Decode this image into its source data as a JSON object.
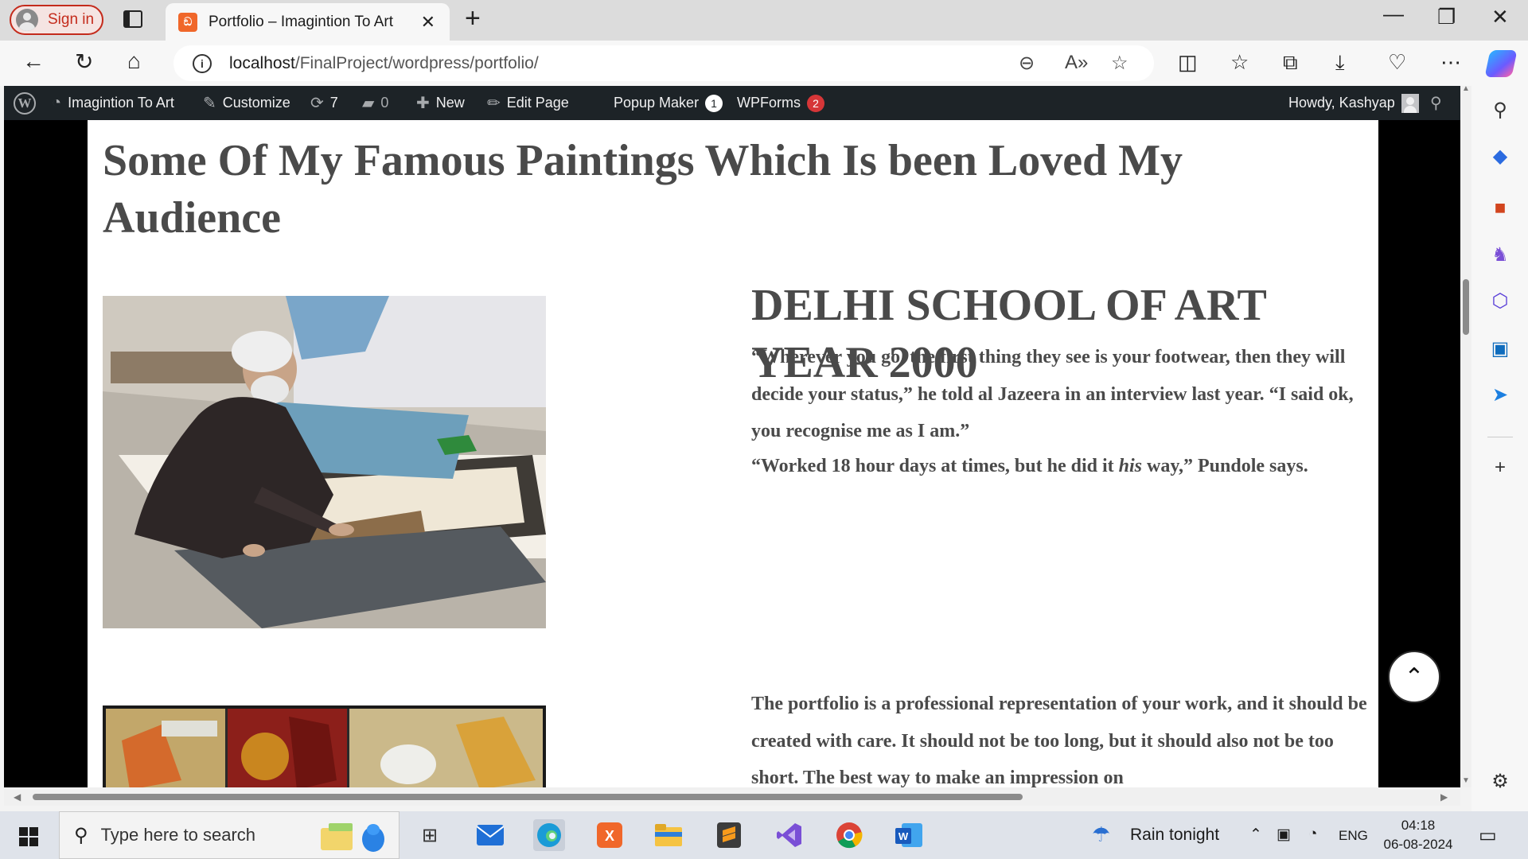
{
  "browser": {
    "signin_label": "Sign in",
    "tab_title": "Portfolio – Imagintion To Art",
    "favicon_text": "ඞ",
    "new_tab_symbol": "+",
    "close_symbol": "✕",
    "url_host": "localhost",
    "url_path": "/FinalProject/wordpress/portfolio/",
    "info_symbol": "i"
  },
  "wpbar": {
    "site_name": "Imagintion To Art",
    "customize": "Customize",
    "updates_count": "7",
    "comments_count": "0",
    "new_label": "New",
    "edit_page": "Edit Page",
    "popup_maker": "Popup Maker",
    "popup_count": "1",
    "wpforms": "WPForms",
    "wpforms_count": "2",
    "howdy": "Howdy, Kashyap"
  },
  "page": {
    "heading": "Some Of My Famous Paintings Which Is been Loved My Audience",
    "subheading": "DELHI SCHOOL OF ART YEAR 2000",
    "quote1": "“Wherever you go, the first thing they see is your footwear, then they will decide your status,” he told al Jazeera in an interview last year. “I said ok, you recognise me as I am.”",
    "quote2_before": "“Worked 18 hour days at times, but he did it ",
    "quote2_em": "his",
    "quote2_after": " way,” Pundole says.",
    "paragraph": "The portfolio is a professional representation of your work, and it should be created with care. It should not be too long, but it should also not be too short. The best way to make an impression on"
  },
  "taskbar": {
    "search_placeholder": "Type here to search",
    "weather": "Rain tonight",
    "language": "ENG",
    "time": "04:18",
    "date": "06-08-2024"
  },
  "colors": {
    "wp_bar": "#1d2327",
    "badge_red": "#d63638",
    "signin_red": "#c42b1c",
    "heading_text": "#4a4a4a"
  }
}
